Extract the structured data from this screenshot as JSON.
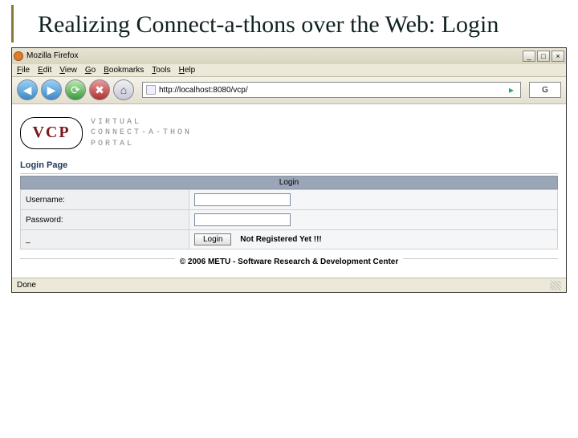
{
  "slide": {
    "title": "Realizing Connect-a-thons over the Web: Login"
  },
  "window": {
    "title": "Mozilla Firefox",
    "min": "_",
    "max": "□",
    "close": "×"
  },
  "menu": {
    "file": "File",
    "edit": "Edit",
    "view": "View",
    "go": "Go",
    "bookmarks": "Bookmarks",
    "tools": "Tools",
    "help": "Help"
  },
  "toolbar": {
    "back": "◀",
    "forward": "▶",
    "reload": "⟳",
    "stop": "✖",
    "home": "⌂",
    "url": "http://localhost:8080/vcp/",
    "go": "▸",
    "search_placeholder": "G"
  },
  "logo": {
    "badge": "VCP",
    "line1": "VIRTUAL",
    "line2": "CONNECT-A-THON",
    "line3": "PORTAL"
  },
  "page": {
    "header": "Login Page",
    "login_bar": "Login",
    "username_label": "Username:",
    "password_label": "Password:",
    "underscore": "_",
    "login_button": "Login",
    "not_registered": "Not Registered Yet !!!",
    "footer": "© 2006 METU - Software Research & Development Center"
  },
  "status": {
    "text": "Done"
  }
}
